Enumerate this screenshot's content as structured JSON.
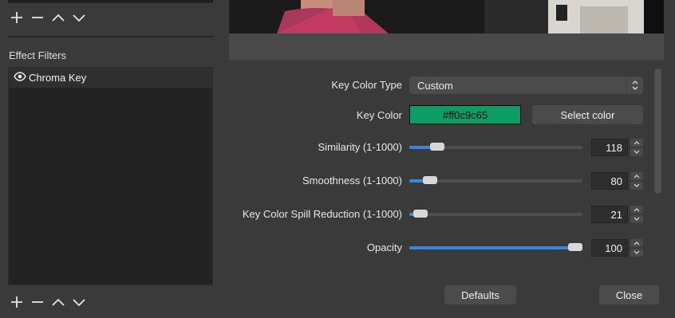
{
  "left": {
    "section_title": "Effect Filters",
    "filters": [
      {
        "label": "Chroma Key",
        "visible": true
      }
    ],
    "toolbar_icons": [
      "add-icon",
      "remove-icon",
      "move-up-icon",
      "move-down-icon"
    ]
  },
  "properties": {
    "key_color_type": {
      "label": "Key Color Type",
      "value": "Custom"
    },
    "key_color": {
      "label": "Key Color",
      "value": "#ff0c9c65",
      "swatch": "#0c9c65",
      "button": "Select color"
    },
    "similarity": {
      "label": "Similarity (1-1000)",
      "value": "118",
      "fraction": 0.118
    },
    "smoothness": {
      "label": "Smoothness (1-1000)",
      "value": "80",
      "fraction": 0.08
    },
    "spill": {
      "label": "Key Color Spill Reduction (1-1000)",
      "value": "21",
      "fraction": 0.021
    },
    "opacity": {
      "label": "Opacity",
      "value": "100",
      "fraction": 1.0
    }
  },
  "footer": {
    "defaults": "Defaults",
    "close": "Close"
  },
  "colors": {
    "accent": "#3d86dd",
    "background": "#3a3a3a"
  }
}
